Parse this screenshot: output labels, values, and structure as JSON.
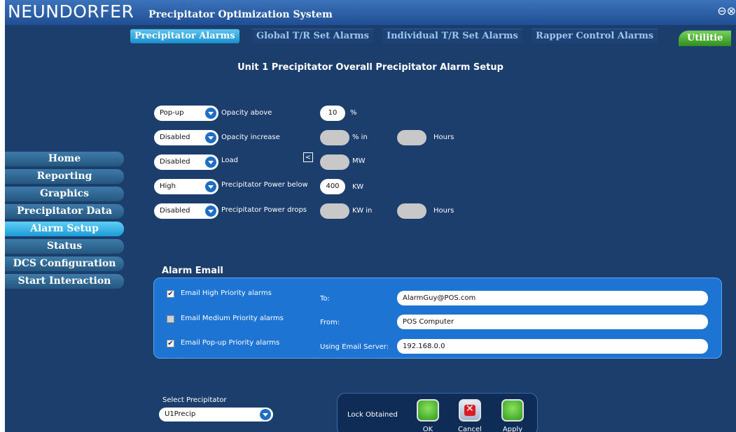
{
  "window": {
    "brand": "NEUNDORFER",
    "title": "Precipitator Optimization System",
    "controls": "⊖⊗"
  },
  "tabs": [
    {
      "label": "Precipitator Alarms",
      "active": true
    },
    {
      "label": "Global T/R Set Alarms",
      "active": false
    },
    {
      "label": "Individual T/R Set Alarms",
      "active": false
    },
    {
      "label": "Rapper Control Alarms",
      "active": false
    },
    {
      "label": "Utilitie",
      "active": false
    }
  ],
  "page_heading": "Unit 1 Precipitator Overall Precipitator Alarm Setup",
  "nav": [
    {
      "label": "Home",
      "active": false
    },
    {
      "label": "Reporting",
      "active": false
    },
    {
      "label": "Graphics",
      "active": false
    },
    {
      "label": "Precipitator Data",
      "active": false
    },
    {
      "label": "Alarm Setup",
      "active": true
    },
    {
      "label": "Status",
      "active": false
    },
    {
      "label": "DCS Configuration",
      "active": false
    },
    {
      "label": "Start Interaction",
      "active": false
    }
  ],
  "alarms": [
    {
      "level": "Pop-up",
      "label": "Opacity above",
      "value": "10",
      "unit": "%",
      "value2": null,
      "unit2": null
    },
    {
      "level": "Disabled",
      "label": "Opacity increase",
      "value": "",
      "unit": "% in",
      "value2": "",
      "unit2": "Hours"
    },
    {
      "level": "Disabled",
      "label": "Load",
      "compare": "<",
      "value": "",
      "unit": "MW",
      "value2": null,
      "unit2": null
    },
    {
      "level": "High",
      "label": "Precipitator Power below",
      "value": "400",
      "unit": "KW",
      "value2": null,
      "unit2": null
    },
    {
      "level": "Disabled",
      "label": "Precipitator Power drops",
      "value": "",
      "unit": "KW in",
      "value2": "",
      "unit2": "Hours"
    }
  ],
  "email": {
    "title": "Alarm Email",
    "options": [
      {
        "label": "Email High Priority alarms",
        "checked": true
      },
      {
        "label": "Email Medium Priority alarms",
        "checked": false
      },
      {
        "label": "Email Pop-up Priority alarms",
        "checked": true
      }
    ],
    "to_label": "To:",
    "to_value": "AlarmGuy@POS.com",
    "from_label": "From:",
    "from_value": "POS Computer",
    "server_label": "Using Email Server:",
    "server_value": "192.168.0.0"
  },
  "select_precipitator": {
    "label": "Select Precipitator",
    "value": "U1Precip"
  },
  "actions": {
    "lock_status": "Lock Obtained",
    "ok_label": "OK",
    "cancel_label": "Cancel",
    "apply_label": "Apply"
  },
  "colors": {
    "background": "#1c3e6c",
    "active_tab": "#1a8fcf",
    "utilities_tab": "#2e8f1e",
    "email_panel": "#1d74d2"
  }
}
